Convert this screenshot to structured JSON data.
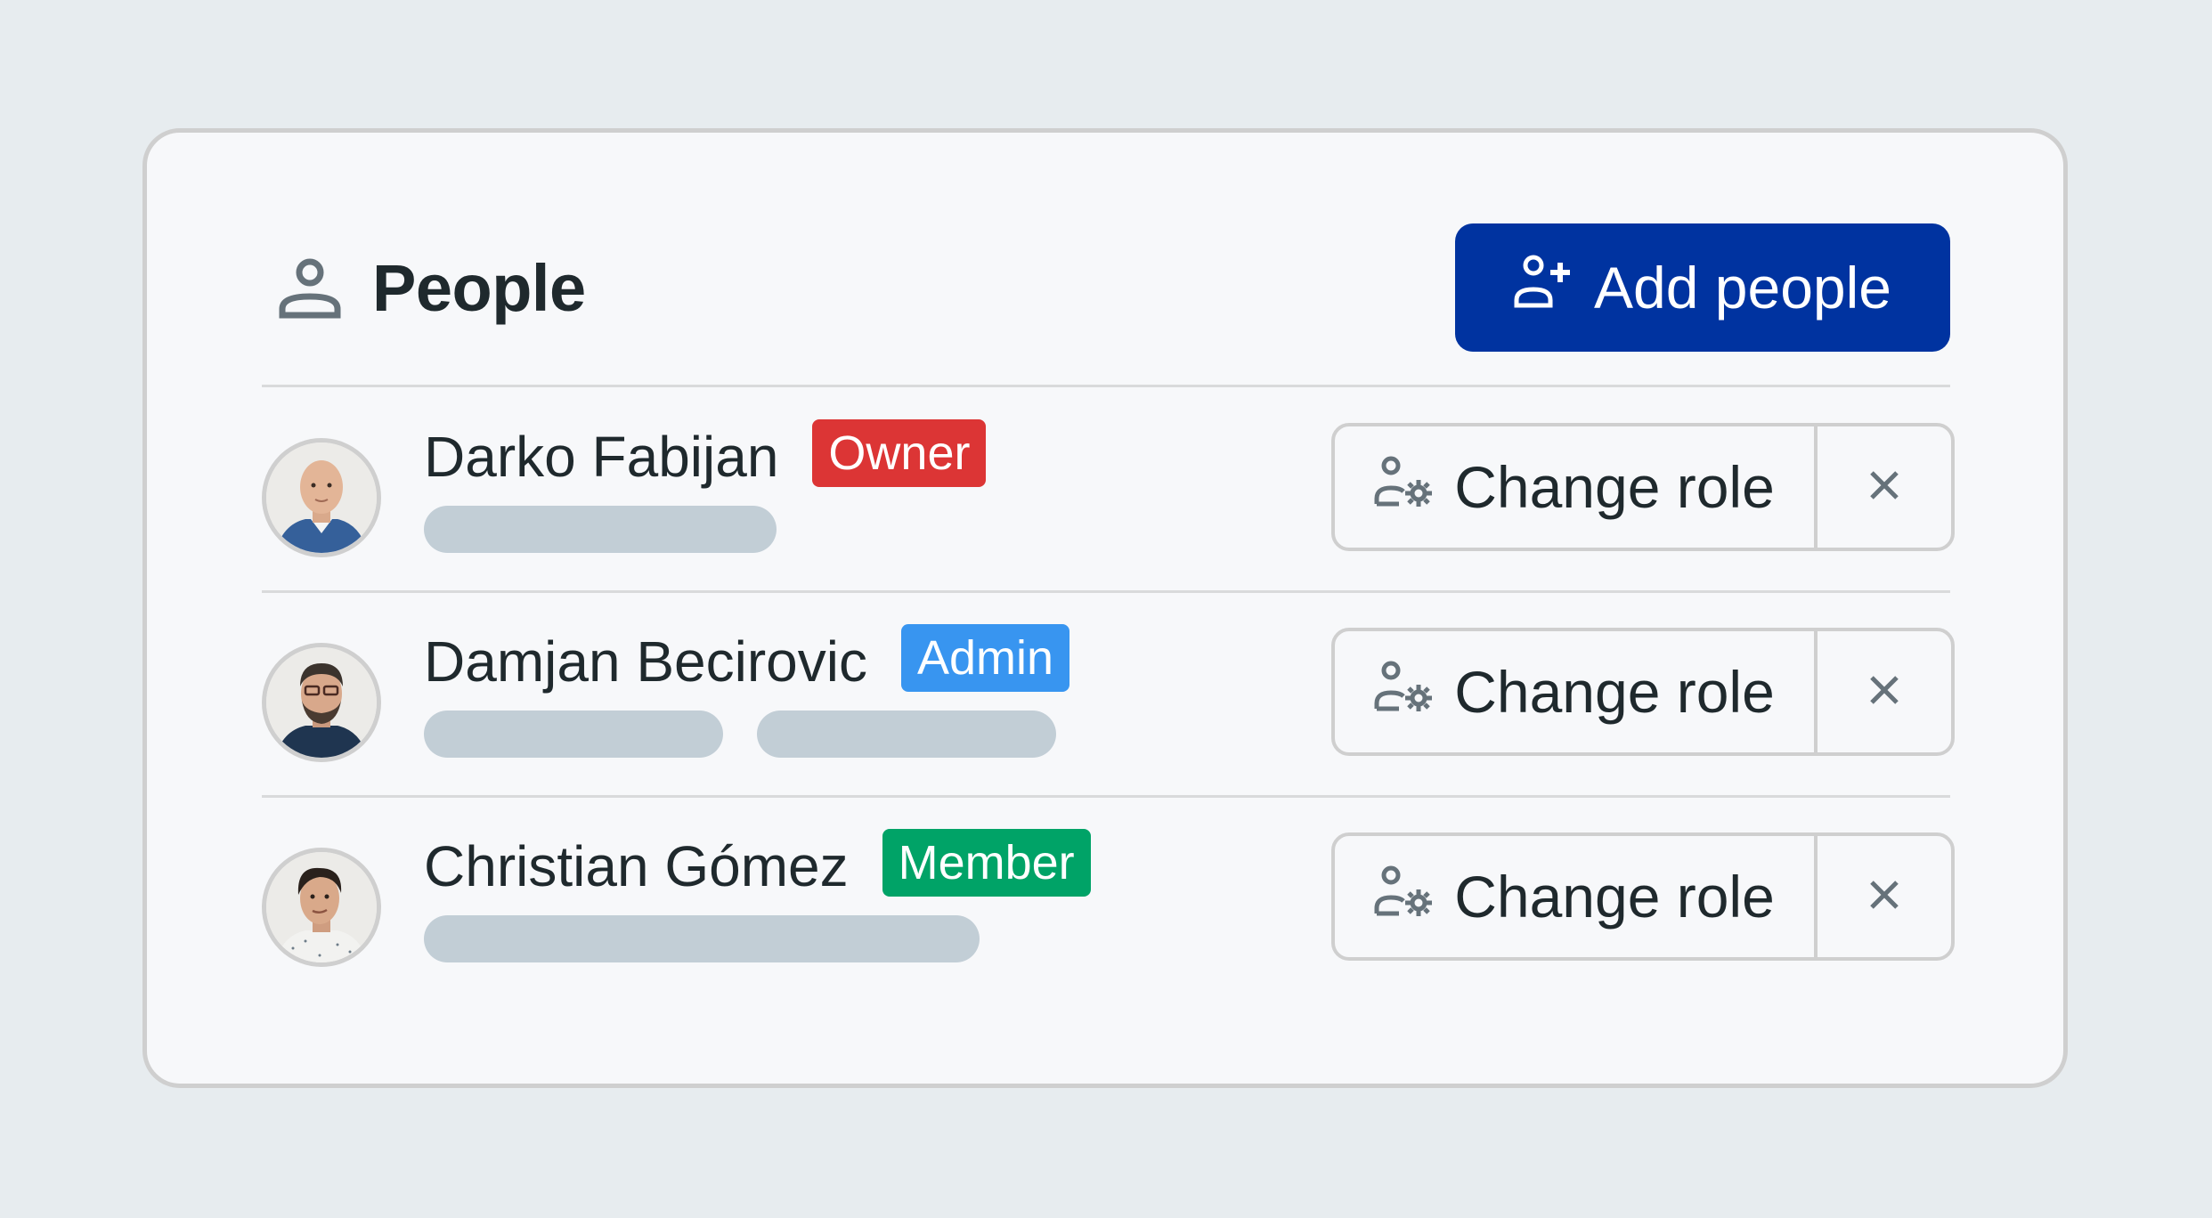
{
  "header": {
    "icon": "person-icon",
    "title": "People",
    "add_button": {
      "icon": "person-add-icon",
      "label": "Add people"
    }
  },
  "colors": {
    "primary": "#0033a0",
    "owner": "#dc3535",
    "admin": "#3895f0",
    "member": "#00a367",
    "skeleton": "#c2ced6",
    "text": "#1f292d",
    "icon": "#66727a"
  },
  "people": [
    {
      "name": "Darko Fabijan",
      "role": "Owner",
      "role_color": "#dc3535",
      "avatar": "photo of bald man in blue shirt",
      "skeleton_bars": 1,
      "change_role_label": "Change role",
      "change_role_icon": "person-gear-icon",
      "remove_icon": "close-icon"
    },
    {
      "name": "Damjan Becirovic",
      "role": "Admin",
      "role_color": "#3895f0",
      "avatar": "photo of bearded man with glasses",
      "skeleton_bars": 2,
      "change_role_label": "Change role",
      "change_role_icon": "person-gear-icon",
      "remove_icon": "close-icon"
    },
    {
      "name": "Christian Gómez",
      "role": "Member",
      "role_color": "#00a367",
      "avatar": "photo of smiling man with dark hair",
      "skeleton_bars": 1,
      "change_role_label": "Change role",
      "change_role_icon": "person-gear-icon",
      "remove_icon": "close-icon"
    }
  ]
}
